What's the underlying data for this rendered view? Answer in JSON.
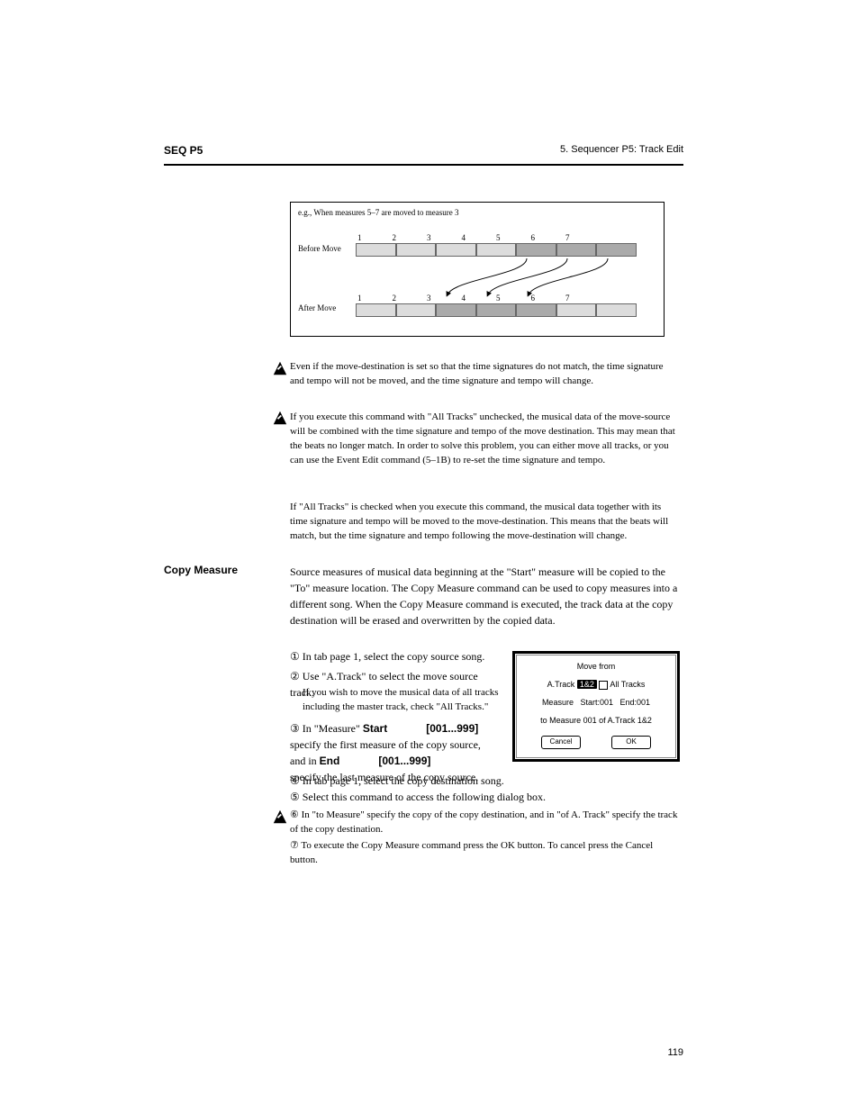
{
  "header": {
    "left": "SEQ P5",
    "right": "5. Sequencer P5: Track Edit"
  },
  "diagram": {
    "eg": "e.g., When measures 5–7 are moved to measure 3",
    "before": "Before Move",
    "after": "After Move",
    "nums_top": [
      "1",
      "2",
      "3",
      "4",
      "5",
      "6",
      "7"
    ],
    "nums_bot": [
      "1",
      "2",
      "3",
      "4",
      "5",
      "6",
      "7"
    ]
  },
  "notes": {
    "n1": "Even if the move-destination is set so that the time signatures do not match, the time signature and tempo will not be moved, and the time signature and tempo will change.",
    "n2": "If you execute this command with \"All Tracks\" unchecked, the musical data of the move-source will be combined with the time signature and tempo of the move destination. This may mean that the beats no longer match. In order to solve this problem, you can either move all tracks, or you can use the Event Edit command (5–1B) to re-set the time signature and tempo.",
    "n2b": "If \"All Tracks\" is checked when you execute this command, the musical data together with its time signature and tempo will be moved to the move-destination. This means that the beats will match, but the time signature and tempo following the move-destination will change."
  },
  "sections": {
    "copy": {
      "title": "Copy Measure",
      "body": "Source measures of musical data beginning at the \"Start\" measure will be copied to the \"To\" measure location. The Copy Measure command can be used to copy measures into a different song. When the Copy Measure command is executed, the track data at the copy destination will be erased and overwritten by the copied data.",
      "step1": "① In tab page 1, select the copy source song.",
      "step2": "② Use \"A.Track\" to select the move source track.",
      "note": "If you wish to move the musical data of all tracks including the master track, check \"All Tracks.\"",
      "step3p1": "③ In \"Measure\" ",
      "step3_start_lbl": "Start",
      "step3_start_rng": "[001...999]",
      "step3p2": " specify the first measure of the copy source, and in ",
      "step3_end_lbl": "End",
      "step3_end_rng": "[001...999]",
      "step3p3": " specify the last measure of the copy source.",
      "step4": "④ In tab page 1, select the copy destination song.",
      "step5": "⑤ Select this command to access the following dialog box.",
      "step6": "⑥ In \"to Measure\" specify the copy of the copy destination, and in \"of A. Track\" specify the track of the copy destination.",
      "step7": "⑦ To execute the Copy Measure command press the OK button. To cancel press the Cancel button."
    }
  },
  "dialog": {
    "title": "Move from",
    "atrack_lbl": "A.Track",
    "atrack_val": "1&2",
    "alltracks": "All Tracks",
    "measure_lbl": "Measure",
    "start_lbl": "Start:001",
    "end_lbl": "End:001",
    "to": "to Measure 001 of A.Track 1&2",
    "cancel": "Cancel",
    "ok": "OK"
  },
  "page": "119"
}
